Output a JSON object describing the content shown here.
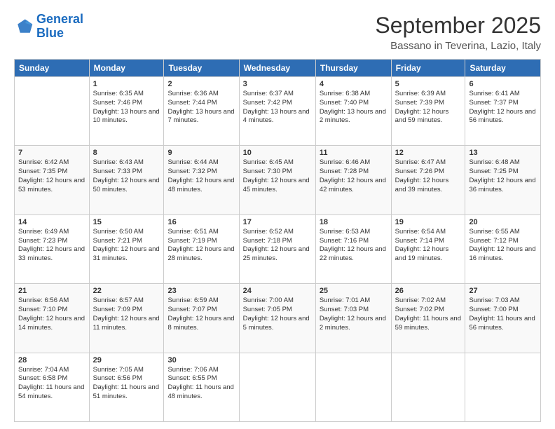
{
  "header": {
    "logo_line1": "General",
    "logo_line2": "Blue",
    "month": "September 2025",
    "location": "Bassano in Teverina, Lazio, Italy"
  },
  "weekdays": [
    "Sunday",
    "Monday",
    "Tuesday",
    "Wednesday",
    "Thursday",
    "Friday",
    "Saturday"
  ],
  "weeks": [
    [
      {
        "day": "",
        "sunrise": "",
        "sunset": "",
        "daylight": ""
      },
      {
        "day": "1",
        "sunrise": "Sunrise: 6:35 AM",
        "sunset": "Sunset: 7:46 PM",
        "daylight": "Daylight: 13 hours and 10 minutes."
      },
      {
        "day": "2",
        "sunrise": "Sunrise: 6:36 AM",
        "sunset": "Sunset: 7:44 PM",
        "daylight": "Daylight: 13 hours and 7 minutes."
      },
      {
        "day": "3",
        "sunrise": "Sunrise: 6:37 AM",
        "sunset": "Sunset: 7:42 PM",
        "daylight": "Daylight: 13 hours and 4 minutes."
      },
      {
        "day": "4",
        "sunrise": "Sunrise: 6:38 AM",
        "sunset": "Sunset: 7:40 PM",
        "daylight": "Daylight: 13 hours and 2 minutes."
      },
      {
        "day": "5",
        "sunrise": "Sunrise: 6:39 AM",
        "sunset": "Sunset: 7:39 PM",
        "daylight": "Daylight: 12 hours and 59 minutes."
      },
      {
        "day": "6",
        "sunrise": "Sunrise: 6:41 AM",
        "sunset": "Sunset: 7:37 PM",
        "daylight": "Daylight: 12 hours and 56 minutes."
      }
    ],
    [
      {
        "day": "7",
        "sunrise": "Sunrise: 6:42 AM",
        "sunset": "Sunset: 7:35 PM",
        "daylight": "Daylight: 12 hours and 53 minutes."
      },
      {
        "day": "8",
        "sunrise": "Sunrise: 6:43 AM",
        "sunset": "Sunset: 7:33 PM",
        "daylight": "Daylight: 12 hours and 50 minutes."
      },
      {
        "day": "9",
        "sunrise": "Sunrise: 6:44 AM",
        "sunset": "Sunset: 7:32 PM",
        "daylight": "Daylight: 12 hours and 48 minutes."
      },
      {
        "day": "10",
        "sunrise": "Sunrise: 6:45 AM",
        "sunset": "Sunset: 7:30 PM",
        "daylight": "Daylight: 12 hours and 45 minutes."
      },
      {
        "day": "11",
        "sunrise": "Sunrise: 6:46 AM",
        "sunset": "Sunset: 7:28 PM",
        "daylight": "Daylight: 12 hours and 42 minutes."
      },
      {
        "day": "12",
        "sunrise": "Sunrise: 6:47 AM",
        "sunset": "Sunset: 7:26 PM",
        "daylight": "Daylight: 12 hours and 39 minutes."
      },
      {
        "day": "13",
        "sunrise": "Sunrise: 6:48 AM",
        "sunset": "Sunset: 7:25 PM",
        "daylight": "Daylight: 12 hours and 36 minutes."
      }
    ],
    [
      {
        "day": "14",
        "sunrise": "Sunrise: 6:49 AM",
        "sunset": "Sunset: 7:23 PM",
        "daylight": "Daylight: 12 hours and 33 minutes."
      },
      {
        "day": "15",
        "sunrise": "Sunrise: 6:50 AM",
        "sunset": "Sunset: 7:21 PM",
        "daylight": "Daylight: 12 hours and 31 minutes."
      },
      {
        "day": "16",
        "sunrise": "Sunrise: 6:51 AM",
        "sunset": "Sunset: 7:19 PM",
        "daylight": "Daylight: 12 hours and 28 minutes."
      },
      {
        "day": "17",
        "sunrise": "Sunrise: 6:52 AM",
        "sunset": "Sunset: 7:18 PM",
        "daylight": "Daylight: 12 hours and 25 minutes."
      },
      {
        "day": "18",
        "sunrise": "Sunrise: 6:53 AM",
        "sunset": "Sunset: 7:16 PM",
        "daylight": "Daylight: 12 hours and 22 minutes."
      },
      {
        "day": "19",
        "sunrise": "Sunrise: 6:54 AM",
        "sunset": "Sunset: 7:14 PM",
        "daylight": "Daylight: 12 hours and 19 minutes."
      },
      {
        "day": "20",
        "sunrise": "Sunrise: 6:55 AM",
        "sunset": "Sunset: 7:12 PM",
        "daylight": "Daylight: 12 hours and 16 minutes."
      }
    ],
    [
      {
        "day": "21",
        "sunrise": "Sunrise: 6:56 AM",
        "sunset": "Sunset: 7:10 PM",
        "daylight": "Daylight: 12 hours and 14 minutes."
      },
      {
        "day": "22",
        "sunrise": "Sunrise: 6:57 AM",
        "sunset": "Sunset: 7:09 PM",
        "daylight": "Daylight: 12 hours and 11 minutes."
      },
      {
        "day": "23",
        "sunrise": "Sunrise: 6:59 AM",
        "sunset": "Sunset: 7:07 PM",
        "daylight": "Daylight: 12 hours and 8 minutes."
      },
      {
        "day": "24",
        "sunrise": "Sunrise: 7:00 AM",
        "sunset": "Sunset: 7:05 PM",
        "daylight": "Daylight: 12 hours and 5 minutes."
      },
      {
        "day": "25",
        "sunrise": "Sunrise: 7:01 AM",
        "sunset": "Sunset: 7:03 PM",
        "daylight": "Daylight: 12 hours and 2 minutes."
      },
      {
        "day": "26",
        "sunrise": "Sunrise: 7:02 AM",
        "sunset": "Sunset: 7:02 PM",
        "daylight": "Daylight: 11 hours and 59 minutes."
      },
      {
        "day": "27",
        "sunrise": "Sunrise: 7:03 AM",
        "sunset": "Sunset: 7:00 PM",
        "daylight": "Daylight: 11 hours and 56 minutes."
      }
    ],
    [
      {
        "day": "28",
        "sunrise": "Sunrise: 7:04 AM",
        "sunset": "Sunset: 6:58 PM",
        "daylight": "Daylight: 11 hours and 54 minutes."
      },
      {
        "day": "29",
        "sunrise": "Sunrise: 7:05 AM",
        "sunset": "Sunset: 6:56 PM",
        "daylight": "Daylight: 11 hours and 51 minutes."
      },
      {
        "day": "30",
        "sunrise": "Sunrise: 7:06 AM",
        "sunset": "Sunset: 6:55 PM",
        "daylight": "Daylight: 11 hours and 48 minutes."
      },
      {
        "day": "",
        "sunrise": "",
        "sunset": "",
        "daylight": ""
      },
      {
        "day": "",
        "sunrise": "",
        "sunset": "",
        "daylight": ""
      },
      {
        "day": "",
        "sunrise": "",
        "sunset": "",
        "daylight": ""
      },
      {
        "day": "",
        "sunrise": "",
        "sunset": "",
        "daylight": ""
      }
    ]
  ]
}
